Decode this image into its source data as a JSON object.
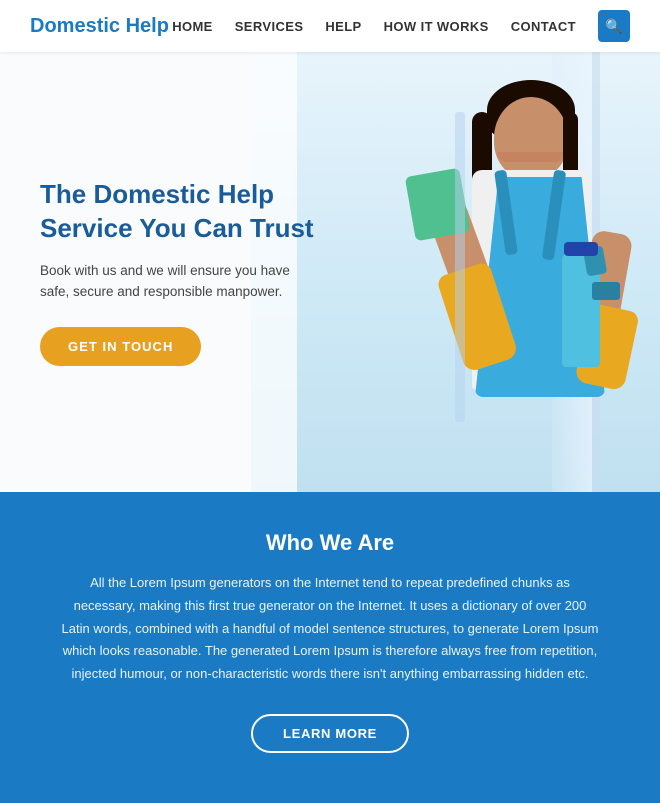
{
  "header": {
    "logo": "Domestic Help",
    "nav": {
      "home": "HOME",
      "services": "SERVICES",
      "help": "HELP",
      "how_it_works": "HOW IT WORKS",
      "contact": "CONTACT"
    },
    "search_icon": "🔍"
  },
  "hero": {
    "title": "The Domestic Help Service You Can Trust",
    "description": "Book with us and we will ensure you have safe, secure and responsible manpower.",
    "cta_button": "GET IN TOUCH"
  },
  "who_section": {
    "title": "Who We Are",
    "text": "All the Lorem Ipsum generators on the Internet tend to repeat predefined chunks as necessary, making this first true generator on the Internet. It uses a dictionary of over 200 Latin words, combined with a handful of model sentence structures, to generate Lorem Ipsum which looks reasonable. The generated Lorem Ipsum is therefore always free from repetition, injected humour, or non-characteristic words there isn't anything embarrassing hidden etc.",
    "learn_button": "LEARN MORE"
  },
  "colors": {
    "brand_blue": "#1a7bc4",
    "hero_title_blue": "#1a5c99",
    "cta_orange": "#e8a020",
    "section_blue": "#1a7bc4"
  }
}
